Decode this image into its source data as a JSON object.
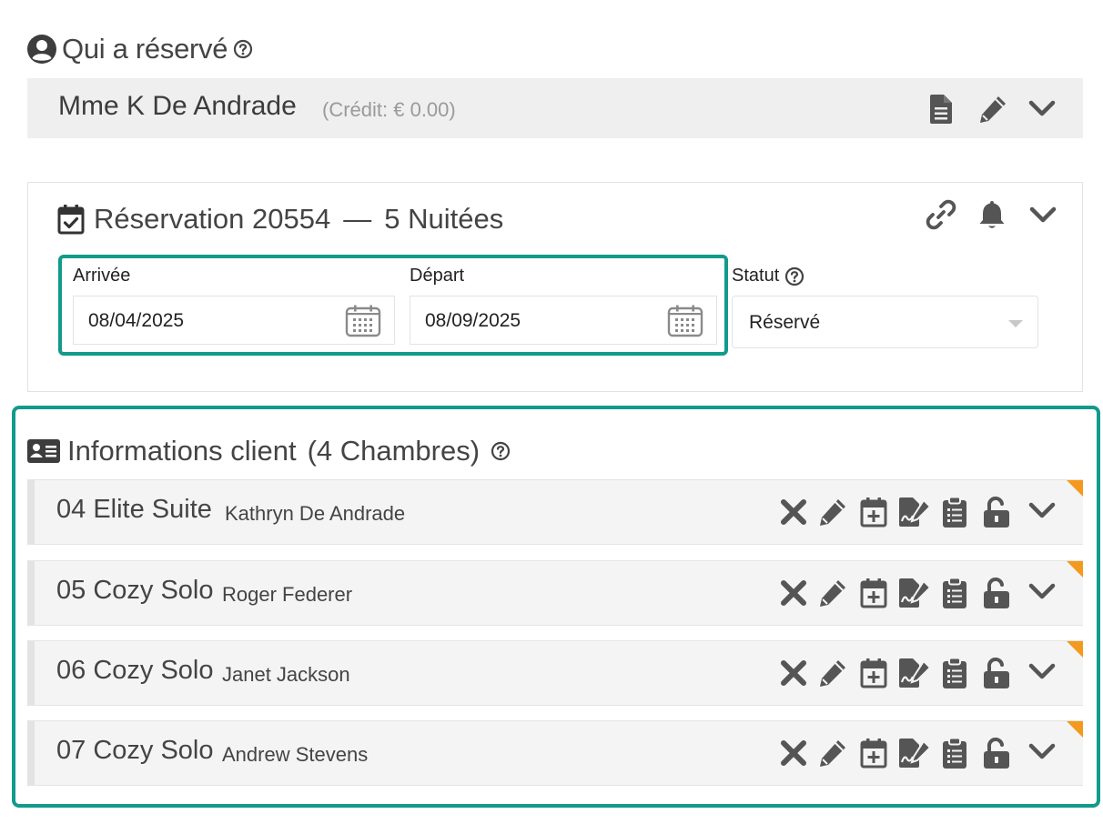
{
  "booker": {
    "title": "Qui a réservé",
    "guest_name": "Mme K De Andrade",
    "credit": "(Crédit: € 0.00)",
    "icons": [
      "user-circle-icon",
      "help-icon",
      "document-icon",
      "pencil-icon",
      "chevron-down-icon"
    ]
  },
  "reservation": {
    "title": "Réservation 20554",
    "separator": "—",
    "nights": "5 Nuitées",
    "arrival_label": "Arrivée",
    "arrival_value": "08/04/2025",
    "departure_label": "Départ",
    "departure_value": "08/09/2025",
    "status_label": "Statut",
    "status_value": "Réservé",
    "icons": [
      "calendar-check-icon",
      "link-icon",
      "bell-icon",
      "chevron-down-icon",
      "calendar-icon"
    ]
  },
  "client_info": {
    "title": "Informations client",
    "count": "(4 Chambres)",
    "rooms": [
      {
        "room": "04 Elite Suite",
        "guest": "Kathryn De Andrade"
      },
      {
        "room": "05 Cozy Solo",
        "guest": "Roger Federer"
      },
      {
        "room": "06 Cozy Solo",
        "guest": "Janet Jackson"
      },
      {
        "room": "07 Cozy Solo",
        "guest": "Andrew Stevens"
      }
    ],
    "row_icons": [
      "close-icon",
      "pencil-icon",
      "calendar-plus-icon",
      "signature-icon",
      "clipboard-list-icon",
      "unlock-icon",
      "chevron-down-icon"
    ]
  },
  "colors": {
    "accent": "#129a8a",
    "flag": "#f39a1e",
    "icon": "#555555"
  }
}
